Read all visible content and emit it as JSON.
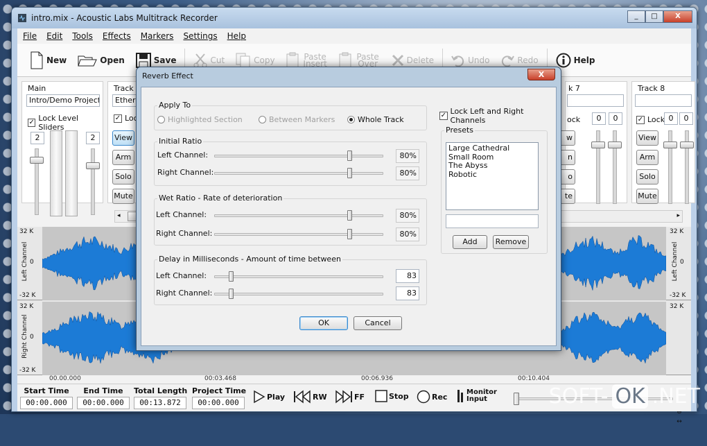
{
  "window": {
    "title": "intro.mix - Acoustic Labs Multitrack Recorder",
    "controls": [
      "_",
      "□",
      "X"
    ]
  },
  "menu": [
    "File",
    "Edit",
    "Tools",
    "Effects",
    "Markers",
    "Settings",
    "Help"
  ],
  "toolbar": {
    "new": "New",
    "open": "Open",
    "save": "Save",
    "cut": "Cut",
    "copy": "Copy",
    "paste_insert": "Paste Insert",
    "paste_over": "Paste Over",
    "delete": "Delete",
    "undo": "Undo",
    "redo": "Redo",
    "help": "Help"
  },
  "mixer": {
    "main": {
      "label": "Main",
      "name": "Intro/Demo Project",
      "lock": "Lock Level Sliders",
      "left_level": "2",
      "right_level": "2"
    },
    "track1": {
      "label": "Track 1",
      "name": "Etherea",
      "lock": "Lock"
    },
    "track7": {
      "label": "k 7",
      "lock": "ock",
      "left": "0",
      "right": "0"
    },
    "track8": {
      "label": "Track 8",
      "name": "",
      "lock": "Lock",
      "left": "0",
      "right": "0"
    },
    "buttons": {
      "view": "View",
      "arm": "Arm",
      "solo": "Solo",
      "mute": "Mute"
    },
    "partial_buttons": {
      "view": "w",
      "arm": "n",
      "solo": "o",
      "mute": "te"
    }
  },
  "waveform": {
    "left_channel": "Left Channel",
    "right_channel": "Right Channel",
    "max": "32 K",
    "zero": "0",
    "min": "-32 K",
    "ruler": [
      "00.00.000",
      "00:03.468",
      "00:06.936",
      "00:10.404"
    ]
  },
  "transport": {
    "start_time": {
      "label": "Start Time",
      "value": "00:00.000"
    },
    "end_time": {
      "label": "End Time",
      "value": "00:00.000"
    },
    "total_length": {
      "label": "Total Length",
      "value": "00:13.872"
    },
    "project_time": {
      "label": "Project Time",
      "value": "00:00.000"
    },
    "play": "Play",
    "rw": "RW",
    "ff": "FF",
    "stop": "Stop",
    "rec": "Rec",
    "monitor": "Monitor",
    "input": "Input"
  },
  "dialog": {
    "title": "Reverb Effect",
    "close": "X",
    "apply_to": {
      "label": "Apply To",
      "options": [
        "Highlighted Section",
        "Between Markers",
        "Whole Track"
      ],
      "selected": "Whole Track"
    },
    "initial_ratio": {
      "label": "Initial Ratio",
      "left_label": "Left Channel:",
      "right_label": "Right Channel:",
      "left": "80%",
      "right": "80%",
      "left_pct": 80,
      "right_pct": 80
    },
    "wet_ratio": {
      "label": "Wet Ratio - Rate of deterioration",
      "left_label": "Left Channel:",
      "right_label": "Right Channel:",
      "left": "80%",
      "right": "80%",
      "left_pct": 80,
      "right_pct": 80
    },
    "delay": {
      "label": "Delay in Milliseconds - Amount of time between",
      "left_label": "Left Channel:",
      "right_label": "Right Channel:",
      "left": "83",
      "right": "83",
      "left_pct": 10,
      "right_pct": 10
    },
    "lock_channels": "Lock Left and Right Channels",
    "presets": {
      "label": "Presets",
      "items": [
        "Large Cathedral",
        "Small Room",
        "The Abyss",
        "Robotic"
      ],
      "name_value": ""
    },
    "add": "Add",
    "remove": "Remove",
    "ok": "OK",
    "cancel": "Cancel"
  },
  "watermark": {
    "a": "SOFT-",
    "b": "OK",
    "c": ".NET"
  }
}
